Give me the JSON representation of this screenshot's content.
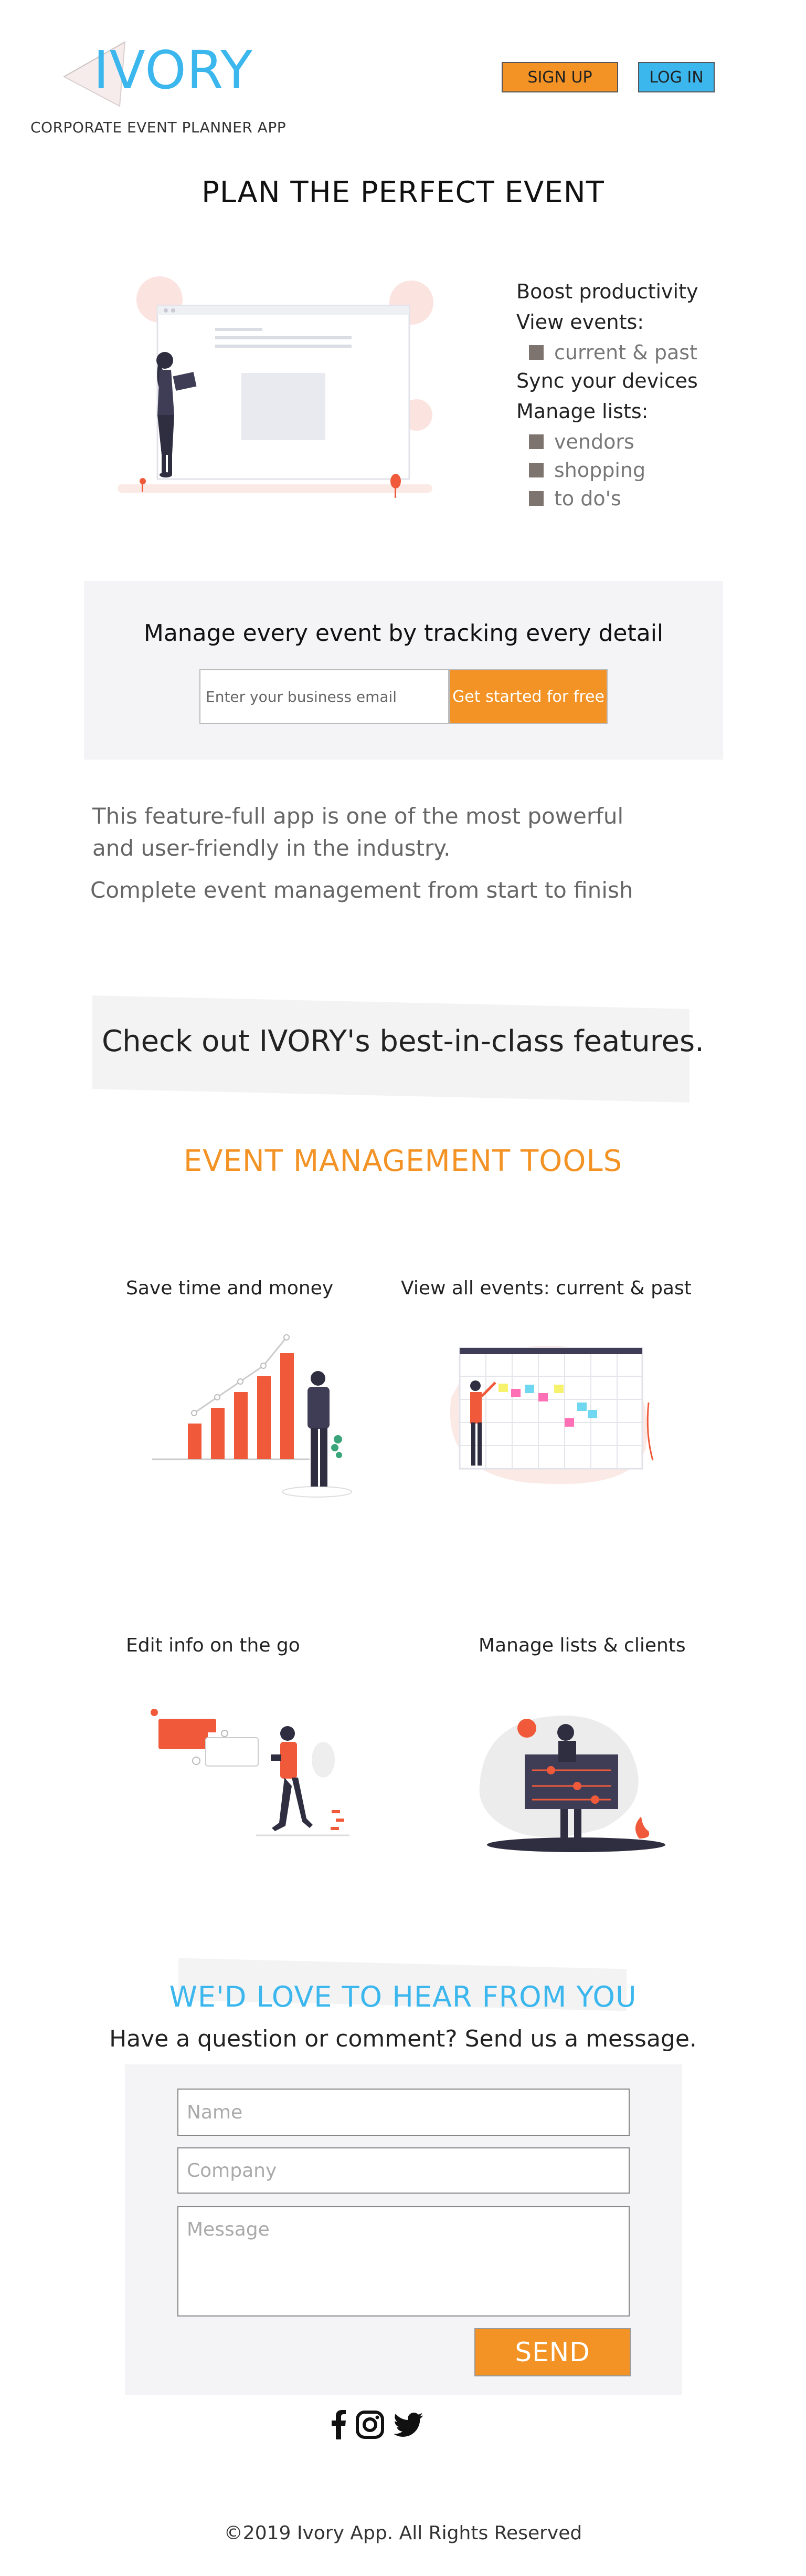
{
  "header": {
    "logo": "IVORY",
    "tagline": "CORPORATE EVENT PLANNER APP",
    "signup_label": "SIGN UP",
    "login_label": "LOG IN"
  },
  "hero": {
    "title": "PLAN THE PERFECT EVENT",
    "features": {
      "boost": "Boost productivity",
      "view_events": "View events:",
      "current_past": "current & past",
      "sync": "Sync your devices",
      "manage_lists": "Manage lists:",
      "vendors": "vendors",
      "shopping": "shopping",
      "todos": "to do's"
    }
  },
  "signup_band": {
    "title": "Manage every event by tracking every detail",
    "email_placeholder": "Enter your business email",
    "cta_label": "Get started for free"
  },
  "about": {
    "paragraph": "This feature-full app is one of the most powerful and user-friendly in the industry.",
    "tagline": "Complete event management from start to finish"
  },
  "features_banner": "Check out IVORY's best-in-class features.",
  "tools": {
    "title": "EVENT MANAGEMENT TOOLS",
    "items": [
      {
        "caption": "Save time and money"
      },
      {
        "caption": "View all events: current & past"
      },
      {
        "caption": "Edit info on the go"
      },
      {
        "caption": "Manage lists & clients"
      }
    ]
  },
  "contact": {
    "title": "WE'D LOVE TO HEAR FROM YOU",
    "subtitle": "Have a question or comment? Send us a message.",
    "name_placeholder": "Name",
    "company_placeholder": "Company",
    "message_placeholder": "Message",
    "send_label": "SEND"
  },
  "social": {
    "icons": [
      "facebook-icon",
      "instagram-icon",
      "twitter-icon"
    ]
  },
  "footer": "©2019 Ivory App. All Rights Reserved",
  "colors": {
    "brand_blue": "#3bb7ee",
    "brand_orange": "#f39325",
    "panel_gray": "#f4f4f6",
    "accent_red": "#f05a3a",
    "dark_navy": "#3f3d56"
  }
}
